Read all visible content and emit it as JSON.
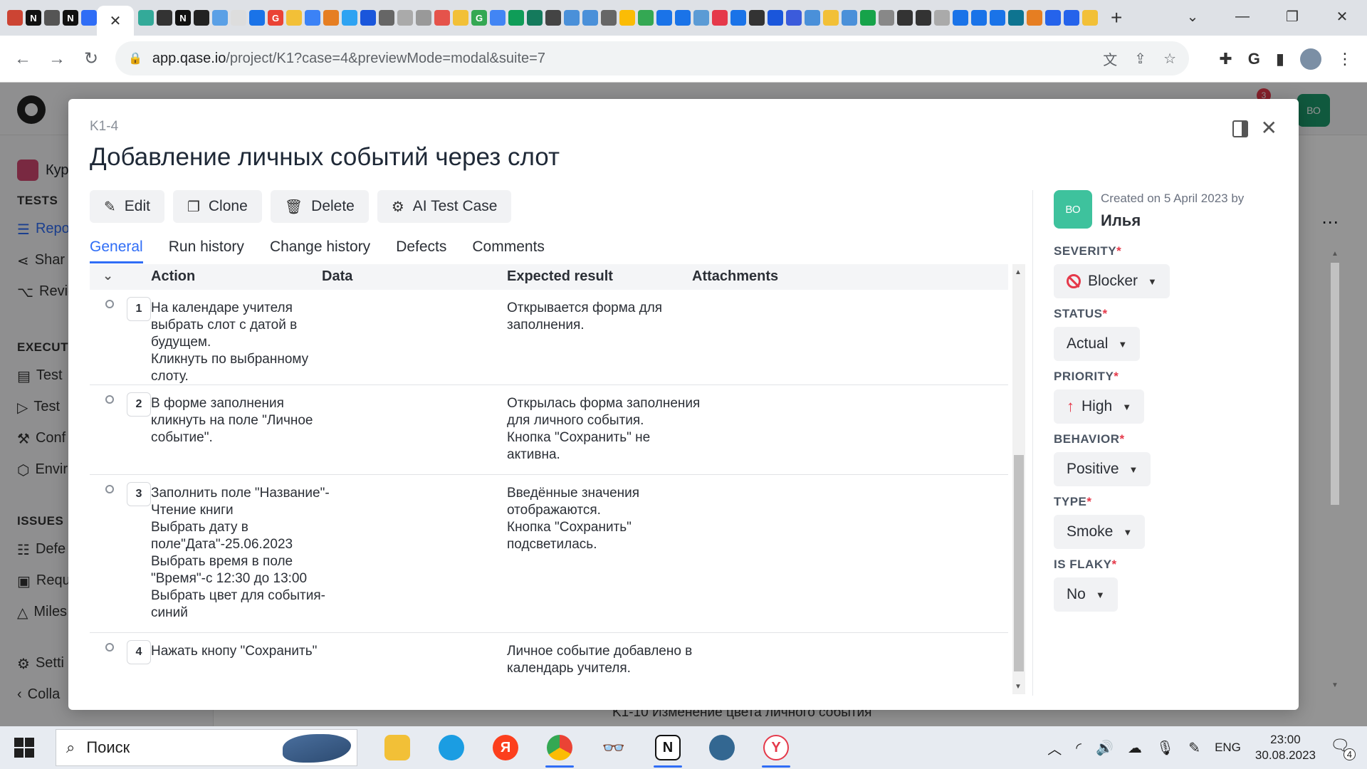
{
  "browser": {
    "url_host": "app.qase.io",
    "url_path": "/project/K1?case=4&previewMode=modal&suite=7",
    "new_tab_label": "+"
  },
  "app": {
    "project_name": "Кур",
    "avatar_initials": "ВО",
    "notification_count": "3",
    "sidebar": {
      "sections": [
        {
          "title": "TESTS",
          "items": [
            {
              "label": "Repo",
              "icon": "list-icon",
              "active": true
            },
            {
              "label": "Shar",
              "icon": "share-icon"
            },
            {
              "label": "Revie",
              "icon": "review-icon"
            }
          ]
        },
        {
          "title": "EXECUTI",
          "items": [
            {
              "label": "Test",
              "icon": "calendar-icon"
            },
            {
              "label": "Test",
              "icon": "play-icon"
            },
            {
              "label": "Conf",
              "icon": "wrench-icon"
            },
            {
              "label": "Envir",
              "icon": "cube-icon"
            }
          ]
        },
        {
          "title": "ISSUES",
          "items": [
            {
              "label": "Defe",
              "icon": "defect-icon"
            },
            {
              "label": "Requ",
              "icon": "doc-icon"
            },
            {
              "label": "Miles",
              "icon": "milestone-icon"
            }
          ]
        }
      ],
      "settings_label": "Setti",
      "collapse_label": "Colla"
    },
    "background_row_text": "K1-10   Изменение цвета личного события"
  },
  "modal": {
    "case_code": "K1-4",
    "title": "Добавление личных событий через слот",
    "actions": [
      {
        "label": "Edit",
        "icon": "pencil-icon"
      },
      {
        "label": "Clone",
        "icon": "clone-icon"
      },
      {
        "label": "Delete",
        "icon": "trash-icon"
      },
      {
        "label": "AI Test Case",
        "icon": "ai-chip-icon"
      }
    ],
    "tabs": [
      "General",
      "Run history",
      "Change history",
      "Defects",
      "Comments"
    ],
    "active_tab": "General",
    "steps_columns": [
      "Action",
      "Data",
      "Expected result",
      "Attachments"
    ],
    "steps": [
      {
        "num": "1",
        "action": "На календаре учителя\nвыбрать слот с датой в\nбудущем.\nКликнуть по выбранному\nслоту.",
        "data": "",
        "expected": "Открывается форма для\nзаполнения."
      },
      {
        "num": "2",
        "action": "В форме заполнения\nкликнуть на поле \"Личное\nсобытие\".",
        "data": "",
        "expected": "Открылась форма заполнения\nдля личного события.\nКнопка \"Сохранить\" не\nактивна."
      },
      {
        "num": "3",
        "action": "Заполнить поле \"Название\"-\nЧтение книги\nВыбрать дату в\nполе\"Дата\"-25.06.2023\nВыбрать время в поле\n\"Время\"-с 12:30 до 13:00\nВыбрать цвет для события-\nсиний",
        "data": "",
        "expected": "Введённые значения\nотображаются.\nКнопка \"Сохранить\"\nподсветилась."
      },
      {
        "num": "4",
        "action": "Нажать кнопу \"Сохранить\"",
        "data": "",
        "expected": "Личное событие добавлено в\nкалендарь учителя."
      }
    ],
    "meta": {
      "creator_initials": "ВО",
      "created_text": "Created on 5 April 2023 by",
      "creator_name": "Илья"
    },
    "properties": [
      {
        "label": "SEVERITY",
        "value": "Blocker",
        "icon": "blocker-icon"
      },
      {
        "label": "STATUS",
        "value": "Actual",
        "icon": ""
      },
      {
        "label": "PRIORITY",
        "value": "High",
        "icon": "arrow-up-icon"
      },
      {
        "label": "BEHAVIOR",
        "value": "Positive",
        "icon": ""
      },
      {
        "label": "TYPE",
        "value": "Smoke",
        "icon": ""
      },
      {
        "label": "IS FLAKY",
        "value": "No",
        "icon": ""
      }
    ],
    "required_mark": "*"
  },
  "taskbar": {
    "search_placeholder": "Поиск",
    "language": "ENG",
    "time": "23:00",
    "date": "30.08.2023",
    "notification_count": "4"
  },
  "colors": {
    "accent": "#2f6df6",
    "danger": "#e5394a",
    "avatar_green": "#3ec29d"
  }
}
